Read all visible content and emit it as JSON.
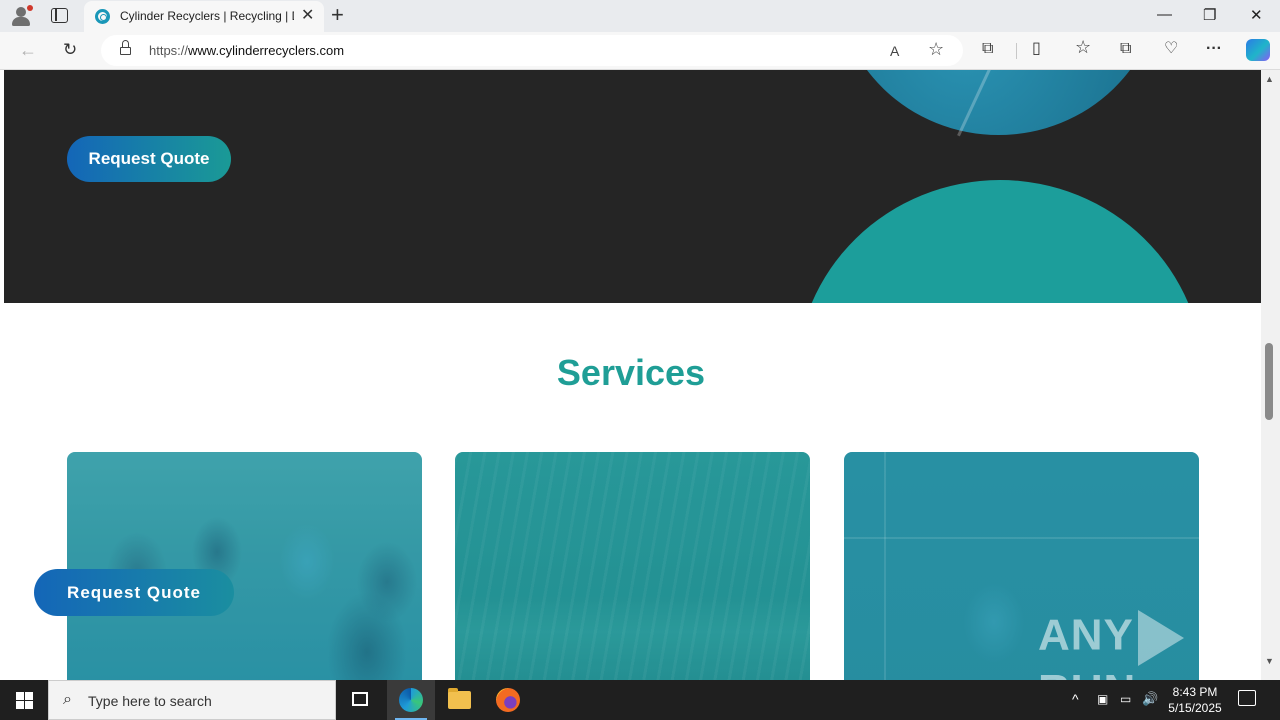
{
  "browser": {
    "tab_title": "Cylinder Recyclers | Recycling | D",
    "tab_close": "✕",
    "new_tab": "+",
    "window_controls": {
      "minimize": "—",
      "restore": "❐",
      "close": "✕"
    },
    "nav": {
      "back": "←",
      "reload": "↻"
    },
    "url_scheme": "https://",
    "url_host": "www.cylinderrecyclers.com",
    "toolbar_icons": {
      "read_aloud": "A",
      "favorite": "☆",
      "extensions": "⧉",
      "split": "▯",
      "favorites": "☆",
      "collections": "⧉",
      "performance": "♡",
      "more": "···"
    }
  },
  "page": {
    "hero": {
      "cta_label": "Request Quote"
    },
    "services": {
      "title": "Services",
      "cards": [
        {
          "image": "cylinders-yard"
        },
        {
          "image": "scrap-pile"
        },
        {
          "image": "processing-equipment"
        }
      ]
    },
    "floating_cta_label": "Request Quote",
    "watermark": {
      "left": "ANY",
      "right": "RUN"
    },
    "colors": {
      "accent": "#1f9e96",
      "button_start": "#1466b8",
      "button_end": "#1a9a96",
      "hero_bg": "#252525"
    }
  },
  "taskbar": {
    "search_placeholder": "Type here to search",
    "search_icon": "⌕",
    "apps": [
      "task-view",
      "microsoft-edge",
      "file-explorer",
      "firefox"
    ],
    "tray": {
      "chevron": "^",
      "speaker": "🔊"
    },
    "time": "8:43 PM",
    "date": "5/15/2025"
  }
}
